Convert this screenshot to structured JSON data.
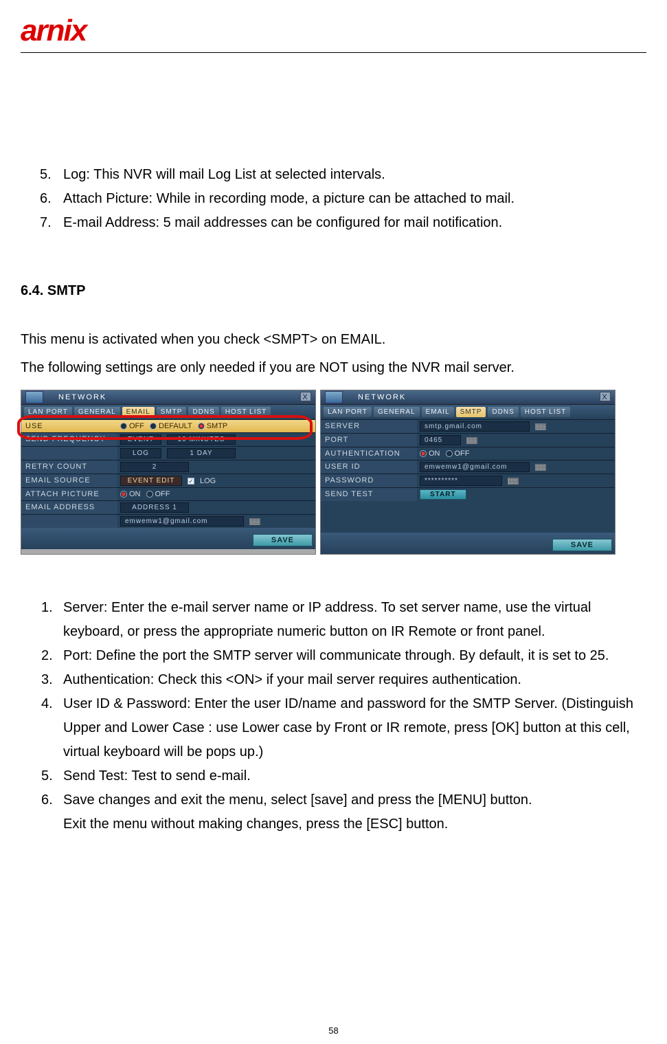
{
  "logo": "arnix",
  "topList": [
    {
      "n": "5.",
      "t": "Log: This NVR will mail Log List at selected intervals."
    },
    {
      "n": "6.",
      "t": "Attach Picture: While in recording mode, a picture can be attached to mail."
    },
    {
      "n": "7.",
      "t": "E-mail Address: 5 mail addresses can be configured for mail notification."
    }
  ],
  "sectionTitle": "6.4.  SMTP",
  "para1": "This menu is activated when you check <SMPT> on EMAIL.",
  "para2": "The following settings are only needed if you are NOT using the NVR mail server.",
  "panelLeft": {
    "title": "NETWORK",
    "close": "X",
    "tabs": [
      "LAN PORT",
      "GENERAL",
      "EMAIL",
      "SMTP",
      "DDNS",
      "HOST LIST"
    ],
    "activeTab": 2,
    "rows": {
      "use": {
        "label": "USE",
        "opts": [
          "OFF",
          "DEFAULT",
          "SMTP"
        ],
        "sel": 2
      },
      "sendFreq": {
        "label": "SEND FREQUENCY",
        "sub1l": "EVENT",
        "sub1v": "10 MINUTES",
        "sub2l": "LOG",
        "sub2v": "1 DAY"
      },
      "retry": {
        "label": "RETRY COUNT",
        "value": "2"
      },
      "emailSource": {
        "label": "EMAIL SOURCE",
        "btn": "EVENT EDIT",
        "chk": "LOG"
      },
      "attach": {
        "label": "ATTACH PICTURE",
        "opts": [
          "ON",
          "OFF"
        ],
        "sel": 0
      },
      "addr": {
        "label": "EMAIL ADDRESS",
        "value": "ADDRESS 1",
        "input": "emwemw1@gmail.com"
      }
    },
    "save": "SAVE"
  },
  "panelRight": {
    "title": "NETWORK",
    "close": "X",
    "tabs": [
      "LAN PORT",
      "GENERAL",
      "EMAIL",
      "SMTP",
      "DDNS",
      "HOST LIST"
    ],
    "activeTab": 3,
    "rows": {
      "server": {
        "label": "SERVER",
        "value": "smtp.gmail.com"
      },
      "port": {
        "label": "PORT",
        "value": "0465"
      },
      "auth": {
        "label": "AUTHENTICATION",
        "opts": [
          "ON",
          "OFF"
        ],
        "sel": 0
      },
      "user": {
        "label": "USER ID",
        "value": "emwemw1@gmail.com"
      },
      "pass": {
        "label": "PASSWORD",
        "value": "**********"
      },
      "test": {
        "label": "SEND TEST",
        "btn": "START"
      }
    },
    "save": "SAVE"
  },
  "bottomList": [
    {
      "n": "1.",
      "t": "Server: Enter the e-mail server name or IP address. To set server name, use the virtual keyboard, or press the appropriate numeric button on IR Remote or front panel."
    },
    {
      "n": "2.",
      "t": "Port: Define the port the SMTP server will communicate through. By default, it is set to 25."
    },
    {
      "n": "3.",
      "t": "Authentication: Check this <ON> if your mail server requires authentication."
    },
    {
      "n": "4.",
      "t": "User ID & Password: Enter the user ID/name and password for the SMTP Server. (Distinguish Upper and Lower Case :   use Lower case by Front or IR remote, press [OK] button at this cell, virtual keyboard will be pops up.)"
    },
    {
      "n": "5.",
      "t": "Send Test: Test to send e-mail."
    },
    {
      "n": "6.",
      "t": "Save changes and exit the menu, select [save] and press the [MENU] button."
    }
  ],
  "exitLine": "Exit the menu without making changes, press the [ESC] button.",
  "pageNumber": "58"
}
